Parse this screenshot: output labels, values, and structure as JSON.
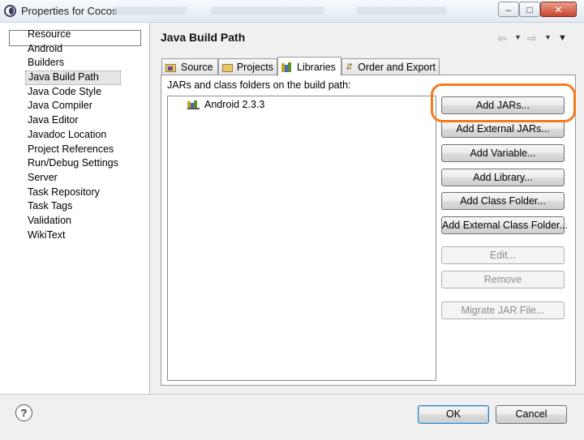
{
  "window": {
    "title": "Properties for Cocos",
    "controls": [
      "minimize",
      "maximize",
      "close"
    ]
  },
  "filter": {
    "value": "",
    "placeholder": ""
  },
  "nav": {
    "items": [
      "Resource",
      "Android",
      "Builders",
      "Java Build Path",
      "Java Code Style",
      "Java Compiler",
      "Java Editor",
      "Javadoc Location",
      "Project References",
      "Run/Debug Settings",
      "Server",
      "Task Repository",
      "Task Tags",
      "Validation",
      "WikiText"
    ],
    "selected": "Java Build Path"
  },
  "page": {
    "title": "Java Build Path"
  },
  "tabs": {
    "source": "Source",
    "projects": "Projects",
    "libraries": "Libraries",
    "order_export": "Order and Export",
    "active": "Libraries"
  },
  "libraries": {
    "label": "JARs and class folders on the build path:",
    "entries": [
      "Android 2.3.3"
    ]
  },
  "buttons": {
    "add_jars": "Add JARs...",
    "add_external_jars": "Add External JARs...",
    "add_variable": "Add Variable...",
    "add_library": "Add Library...",
    "add_class_folder": "Add Class Folder...",
    "add_external_class_folder": "Add External Class Folder...",
    "edit": "Edit...",
    "remove": "Remove",
    "migrate_jar": "Migrate JAR File..."
  },
  "dialog": {
    "help": "?",
    "ok": "OK",
    "cancel": "Cancel"
  },
  "colors": {
    "highlight": "#f47b20",
    "default_button": "#3c7fb1"
  }
}
